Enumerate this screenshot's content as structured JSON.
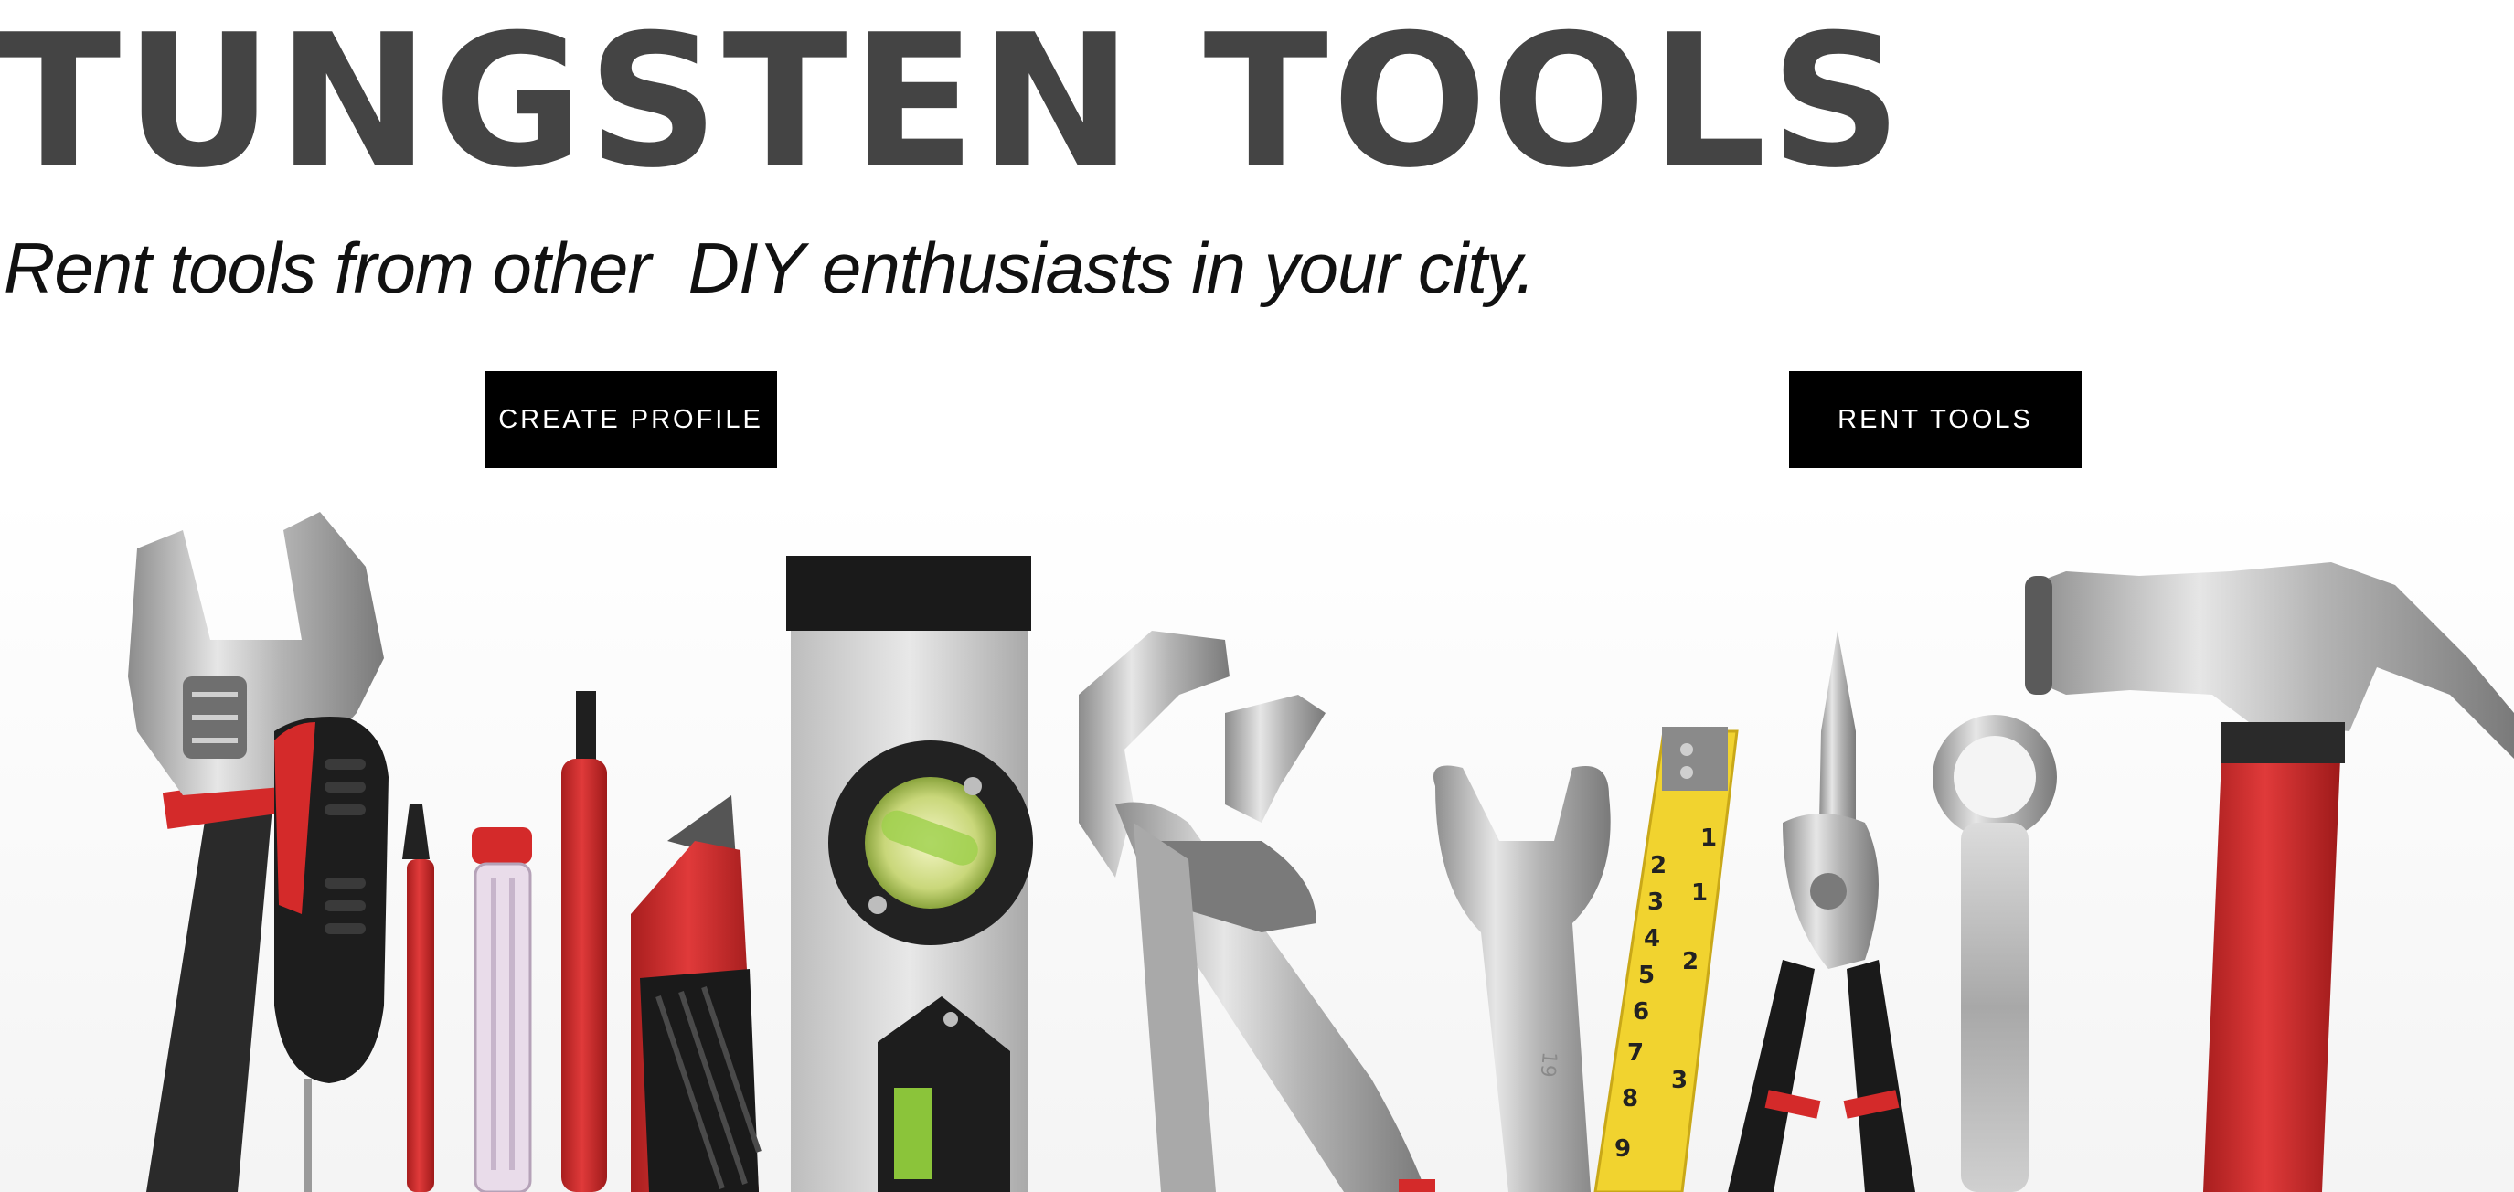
{
  "brand": {
    "title": "TUNGSTEN TOOLS",
    "tagline": "Rent tools from other  DIY enthusiasts in your city."
  },
  "actions": {
    "create_profile_label": "CREATE PROFILE",
    "rent_tools_label": "RENT TOOLS"
  },
  "hero": {
    "tools": [
      "adjustable-wrench",
      "screwdriver",
      "small-screwdriver",
      "voltage-tester",
      "flathead-screwdriver",
      "utility-knife",
      "spirit-level",
      "tongue-and-groove-pliers",
      "open-end-wrench",
      "tape-measure",
      "needle-nose-pliers",
      "combination-wrench",
      "claw-hammer"
    ],
    "tape_marks": [
      "1",
      "2",
      "3",
      "4",
      "5",
      "6",
      "7",
      "8",
      "9"
    ],
    "tape_inches": [
      "1",
      "2",
      "3"
    ],
    "wrench_size": "19"
  },
  "colors": {
    "title": "#444444",
    "button_bg": "#000000",
    "button_text": "#ffffff",
    "accent_red": "#d42a2a",
    "tape_yellow": "#f1d32f"
  }
}
